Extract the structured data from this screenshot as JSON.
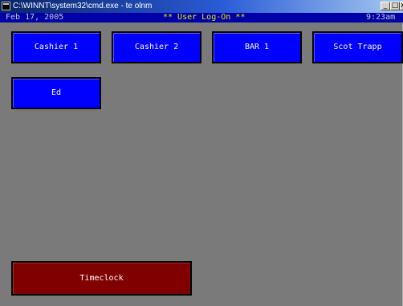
{
  "window": {
    "title": "C:\\WINNT\\system32\\cmd.exe - te olnm",
    "minimize_glyph": "_",
    "maximize_glyph": "□",
    "close_glyph": "x"
  },
  "status": {
    "date": "Feb 17, 2005",
    "screen_title": "** User Log-On **",
    "time": "9:23am"
  },
  "users": [
    {
      "label": "Cashier 1"
    },
    {
      "label": "Cashier 2"
    },
    {
      "label": "BAR 1"
    },
    {
      "label": "Scot Trapp"
    },
    {
      "label": "Ed"
    }
  ],
  "timeclock": {
    "label": "Timeclock"
  },
  "colors": {
    "user_button": "#0000ff",
    "timeclock_button": "#800000",
    "background": "#7a7a7a",
    "status_bar": "#0000a8",
    "title_text": "#e8e800"
  }
}
